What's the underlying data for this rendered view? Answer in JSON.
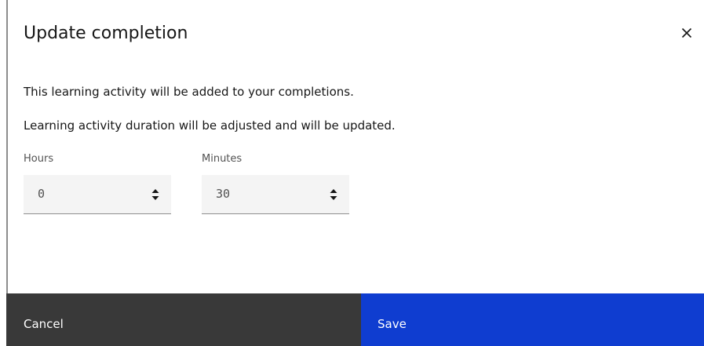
{
  "modal": {
    "title": "Update completion",
    "close_icon": "close-icon",
    "message_1": "This learning activity will be added to your completions.",
    "message_2": "Learning activity duration will be adjusted and will be updated.",
    "fields": {
      "hours": {
        "label": "Hours",
        "value": "0"
      },
      "minutes": {
        "label": "Minutes",
        "value": "30"
      }
    },
    "footer": {
      "cancel_label": "Cancel",
      "save_label": "Save"
    }
  },
  "colors": {
    "text_primary": "#161616",
    "text_secondary": "#525252",
    "input_bg": "#f4f4f4",
    "cancel_bg": "#393939",
    "save_bg": "#0f3dd0",
    "left_rule": "#8d8d8d"
  }
}
